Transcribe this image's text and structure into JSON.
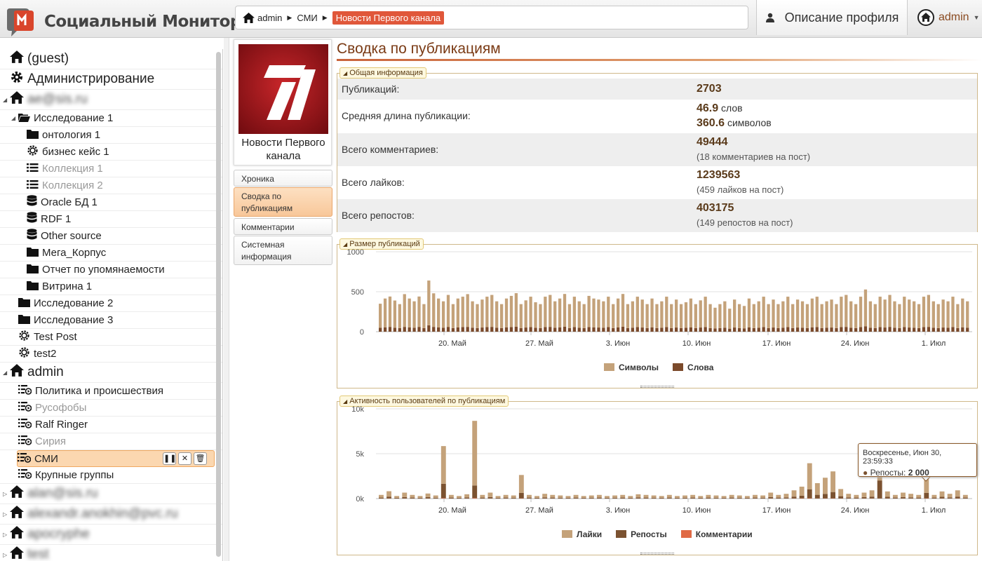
{
  "app": {
    "title": "Социальный Монитор"
  },
  "breadcrumb": {
    "home": "admin",
    "level1": "СМИ",
    "current": "Новости Первого канала"
  },
  "header": {
    "profile_tab": "Описание профиля",
    "user": "admin"
  },
  "sidebar": {
    "items": [
      {
        "label": "(guest)",
        "icon": "home-icon",
        "level": 0,
        "big": true
      },
      {
        "label": "Администрирование",
        "icon": "gear-icon",
        "level": 0,
        "big": true
      },
      {
        "label": "ae@sis.ru",
        "icon": "home-icon",
        "level": 0,
        "big": true,
        "blurred": true,
        "expanded": true
      },
      {
        "label": "Исследование 1",
        "icon": "folder-open-icon",
        "level": 1,
        "expanded": true
      },
      {
        "label": "онтология 1",
        "icon": "folder-icon",
        "level": 2
      },
      {
        "label": "бизнес кейс 1",
        "icon": "cog-icon",
        "level": 2
      },
      {
        "label": "Коллекция 1",
        "icon": "list-icon",
        "level": 2,
        "muted": true
      },
      {
        "label": "Коллекция 2",
        "icon": "list-icon",
        "level": 2,
        "muted": true
      },
      {
        "label": "Oracle БД 1",
        "icon": "database-icon",
        "level": 2
      },
      {
        "label": "RDF 1",
        "icon": "database-icon",
        "level": 2
      },
      {
        "label": "Other source",
        "icon": "database-icon",
        "level": 2
      },
      {
        "label": "Мега_Корпус",
        "icon": "folder-icon",
        "level": 2
      },
      {
        "label": "Отчет по упомянаемости",
        "icon": "folder-icon",
        "level": 2
      },
      {
        "label": "Витрина 1",
        "icon": "folder-icon",
        "level": 2
      },
      {
        "label": "Исследование 2",
        "icon": "folder-icon",
        "level": 1
      },
      {
        "label": "Исследование 3",
        "icon": "folder-icon",
        "level": 1
      },
      {
        "label": "Test Post",
        "icon": "cog-icon",
        "level": 1
      },
      {
        "label": "test2",
        "icon": "cog-icon",
        "level": 1
      },
      {
        "label": "admin",
        "icon": "home-icon",
        "level": 0,
        "big": true,
        "expanded": true
      },
      {
        "label": "Политика и происшествия",
        "icon": "monitor-list-icon",
        "level": 1
      },
      {
        "label": "Русофобы",
        "icon": "monitor-list-icon",
        "level": 1,
        "muted": true
      },
      {
        "label": "Ralf Ringer",
        "icon": "monitor-list-icon",
        "level": 1
      },
      {
        "label": "Сирия",
        "icon": "monitor-list-icon",
        "level": 1,
        "muted": true
      },
      {
        "label": "СМИ",
        "icon": "monitor-list-icon",
        "level": 1,
        "selected": true
      },
      {
        "label": "Крупные группы",
        "icon": "monitor-list-icon",
        "level": 1
      },
      {
        "label": "alan@sis.ru",
        "icon": "home-icon",
        "level": 0,
        "big": true,
        "blurred": true,
        "collapsed": true
      },
      {
        "label": "alexandr.anokhin@pvc.ru",
        "icon": "home-icon",
        "level": 0,
        "big": true,
        "blurred": true,
        "collapsed": true
      },
      {
        "label": "apocryphe",
        "icon": "home-icon",
        "level": 0,
        "big": true,
        "blurred": true,
        "collapsed": true
      },
      {
        "label": "test",
        "icon": "home-icon",
        "level": 0,
        "big": true,
        "blurred": true,
        "collapsed": true
      }
    ],
    "row_actions": [
      "pause-icon",
      "tools-icon",
      "trash-icon"
    ]
  },
  "source": {
    "name": "Новости Первого канала"
  },
  "side_menu": [
    {
      "label": "Хроника",
      "active": false
    },
    {
      "label": "Сводка по публикациям",
      "active": true
    },
    {
      "label": "Комментарии",
      "active": false
    },
    {
      "label": "Системная информация",
      "active": false
    }
  ],
  "main": {
    "title": "Сводка по публикациям",
    "info_section": "Общая информация",
    "info": {
      "publications_label": "Публикаций:",
      "publications": "2703",
      "avg_len_label": "Средняя длина публикации:",
      "avg_words": "46.9",
      "avg_words_unit": "слов",
      "avg_chars": "360.6",
      "avg_chars_unit": "символов",
      "comments_label": "Всего комментариев:",
      "comments": "49444",
      "comments_sub": "(18 комментариев на пост)",
      "likes_label": "Всего лайков:",
      "likes": "1239563",
      "likes_sub": "(459 лайков на пост)",
      "reposts_label": "Всего репостов:",
      "reposts": "403175",
      "reposts_sub": "(149 репостов на пост)"
    },
    "size_section": "Размер публикаций",
    "activity_section": "Активность пользователей по публикациям"
  },
  "colors": {
    "chars": "#c4a27a",
    "words": "#7b4a2b",
    "likes": "#c4a27a",
    "reposts": "#7b5230",
    "comments": "#e06a45"
  },
  "chart_data": [
    {
      "type": "bar",
      "title": "Размер публикаций",
      "x_ticks": [
        "20. Май",
        "27. Май",
        "3. Июн",
        "10. Июн",
        "17. Июн",
        "24. Июн",
        "1. Июл"
      ],
      "y_ticks": [
        "1000",
        "500",
        "0"
      ],
      "ylim": [
        0,
        1000
      ],
      "series": [
        {
          "name": "Символы",
          "values": [
            300,
            360,
            380,
            340,
            300,
            410,
            360,
            330,
            380,
            300,
            560,
            420,
            360,
            330,
            400,
            300,
            360,
            380,
            410,
            330,
            300,
            350,
            380,
            400,
            330,
            300,
            360,
            390,
            420,
            300,
            340,
            380,
            320,
            300,
            380,
            400,
            330,
            360,
            410,
            300,
            380,
            330,
            300,
            390,
            360,
            350,
            330,
            380,
            300,
            360,
            410,
            300,
            330,
            380,
            350,
            300,
            360,
            300,
            330,
            380,
            300,
            350,
            300,
            320,
            360,
            300,
            340,
            380,
            300,
            260,
            300,
            330,
            250,
            350,
            300,
            280,
            360,
            300,
            330,
            380,
            300,
            350,
            300,
            330,
            380,
            300,
            350,
            330,
            300,
            360,
            380,
            300,
            330,
            350,
            300,
            380,
            400,
            330,
            300,
            380,
            460,
            330,
            300,
            380,
            350,
            400,
            330,
            300,
            380,
            350,
            330,
            300,
            380,
            400,
            330,
            300,
            350,
            330,
            380,
            300,
            360,
            330
          ]
        },
        {
          "name": "Слова",
          "values": [
            50,
            55,
            60,
            50,
            45,
            60,
            55,
            50,
            60,
            45,
            80,
            60,
            55,
            50,
            60,
            45,
            55,
            58,
            60,
            50,
            45,
            52,
            58,
            60,
            50,
            45,
            55,
            58,
            62,
            45,
            52,
            58,
            48,
            45,
            58,
            60,
            50,
            55,
            62,
            45,
            58,
            50,
            45,
            58,
            55,
            52,
            50,
            58,
            45,
            55,
            62,
            45,
            50,
            58,
            52,
            45,
            55,
            45,
            50,
            58,
            45,
            52,
            45,
            48,
            55,
            45,
            52,
            58,
            45,
            40,
            45,
            50,
            38,
            52,
            45,
            42,
            55,
            45,
            50,
            58,
            45,
            52,
            45,
            50,
            58,
            45,
            52,
            50,
            45,
            55,
            58,
            45,
            50,
            52,
            45,
            58,
            60,
            50,
            45,
            58,
            68,
            50,
            45,
            58,
            52,
            60,
            50,
            45,
            58,
            52,
            50,
            45,
            58,
            60,
            50,
            45,
            52,
            50,
            58,
            45,
            55,
            50
          ]
        }
      ],
      "legend": "bottom-center"
    },
    {
      "type": "bar",
      "title": "Активность пользователей по публикациям",
      "x_ticks": [
        "20. Май",
        "27. Май",
        "3. Июн",
        "10. Июн",
        "17. Июн",
        "24. Июн",
        "1. Июл"
      ],
      "y_ticks": [
        "10k",
        "5k",
        "0k"
      ],
      "ylim": [
        0,
        10000
      ],
      "series": [
        {
          "name": "Лайки",
          "values": [
            300,
            600,
            200,
            500,
            300,
            200,
            400,
            250,
            4200,
            300,
            200,
            350,
            7200,
            300,
            500,
            200,
            300,
            250,
            2000,
            300,
            200,
            400,
            300,
            250,
            200,
            300,
            200,
            250,
            300,
            200,
            250,
            300,
            200,
            350,
            300,
            250,
            200,
            300,
            200,
            250,
            300,
            200,
            300,
            250,
            200,
            300,
            250,
            200,
            300,
            250,
            500,
            300,
            400,
            700,
            1000,
            2900,
            1300,
            1800,
            2300,
            800,
            400,
            300,
            500,
            700,
            400,
            600,
            300,
            500,
            400,
            300,
            2000,
            300,
            600,
            400,
            700,
            300
          ]
        },
        {
          "name": "Репосты",
          "values": [
            100,
            200,
            80,
            150,
            100,
            80,
            150,
            90,
            1600,
            100,
            80,
            120,
            1400,
            100,
            150,
            80,
            100,
            90,
            600,
            100,
            80,
            120,
            100,
            90,
            80,
            100,
            80,
            90,
            100,
            80,
            90,
            100,
            80,
            120,
            100,
            90,
            80,
            100,
            80,
            90,
            100,
            80,
            100,
            90,
            80,
            100,
            90,
            80,
            100,
            90,
            150,
            100,
            120,
            200,
            300,
            1000,
            400,
            500,
            700,
            250,
            120,
            100,
            150,
            200,
            2000,
            180,
            100,
            150,
            120,
            100,
            600,
            100,
            180,
            120,
            200,
            100
          ]
        },
        {
          "name": "Комментарии",
          "values": [
            10,
            20,
            8,
            15,
            10,
            8,
            15,
            9,
            50,
            10,
            8,
            12,
            60,
            10,
            15,
            8,
            10,
            9,
            30,
            10,
            8,
            12,
            10,
            9,
            8,
            10,
            8,
            9,
            10,
            8,
            9,
            10,
            8,
            12,
            10,
            9,
            8,
            10,
            8,
            9,
            10,
            8,
            10,
            9,
            8,
            10,
            9,
            8,
            10,
            9,
            15,
            10,
            12,
            20,
            30,
            40,
            20,
            25,
            30,
            15,
            12,
            10,
            15,
            20,
            20,
            18,
            10,
            15,
            12,
            10,
            30,
            10,
            18,
            12,
            20,
            10
          ]
        }
      ],
      "tooltip": {
        "header": "Воскресенье, Июн 30, 23:59:33",
        "series": "Репосты",
        "value": "2 000"
      },
      "legend": "bottom-center"
    }
  ]
}
